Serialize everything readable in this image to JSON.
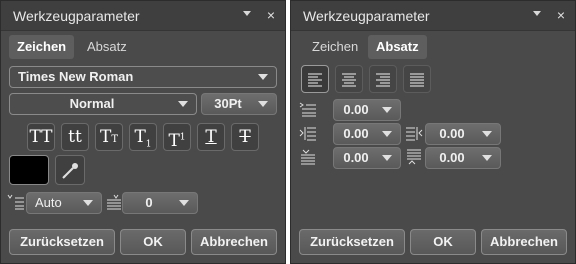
{
  "left_panel": {
    "title": "Werkzeugparameter",
    "tabs": [
      {
        "label": "Zeichen",
        "active": true
      },
      {
        "label": "Absatz",
        "active": false
      }
    ],
    "font_family": "Times New Roman",
    "font_style": "Normal",
    "font_size": "30Pt",
    "text_style_buttons": [
      "all-caps",
      "lowercase",
      "small-caps",
      "subscript",
      "superscript",
      "underline",
      "strikethrough"
    ],
    "glyphs": {
      "allcaps": "TT",
      "lower": "tt",
      "smallcaps_big": "T",
      "smallcaps_small": "T",
      "sub_big": "T",
      "sub_small": "1",
      "sup_big": "T",
      "sup_small": "1",
      "underline": "T",
      "strike": "T"
    },
    "color": "#000000",
    "leading_value": "Auto",
    "tracking_value": "0",
    "buttons": {
      "reset": "Zurücksetzen",
      "ok": "OK",
      "cancel": "Abbrechen"
    }
  },
  "right_panel": {
    "title": "Werkzeugparameter",
    "tabs": [
      {
        "label": "Zeichen",
        "active": false
      },
      {
        "label": "Absatz",
        "active": true
      }
    ],
    "alignment_options": [
      "align-left",
      "align-center",
      "align-right",
      "justify"
    ],
    "active_alignment": "align-left",
    "first_line_indent": "0.00",
    "left_indent": "0.00",
    "right_indent": "0.00",
    "space_before": "0.00",
    "space_after": "0.00",
    "buttons": {
      "reset": "Zurücksetzen",
      "ok": "OK",
      "cancel": "Abbrechen"
    }
  },
  "colors": {
    "panel_bg": "#4a4a4a",
    "titlebar_bg": "#3f3f3f",
    "text": "#e8e8e8"
  }
}
